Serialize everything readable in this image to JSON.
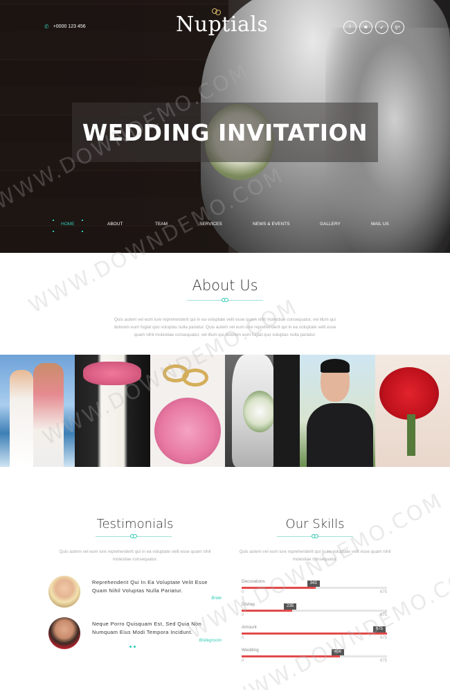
{
  "header": {
    "phone": "+0000 123 456",
    "phone_icon": "phone-icon",
    "logo_text": "Nuptials",
    "social": [
      {
        "icon": "facebook-icon",
        "glyph": "f"
      },
      {
        "icon": "instagram-icon",
        "glyph": "◙"
      },
      {
        "icon": "twitter-icon",
        "glyph": "✔"
      },
      {
        "icon": "google-plus-icon",
        "glyph": "g+"
      }
    ]
  },
  "hero": {
    "title": "WEDDING INVITATION"
  },
  "nav": [
    "HOME",
    "ABOUT",
    "TEAM",
    "SERVICES",
    "NEWS & EVENTS",
    "GALLERY",
    "MAIL US"
  ],
  "about": {
    "title": "About Us",
    "text_lines": [
      "Quis autem vel eum iure reprehenderit qui in ea voluptate velit esse quam nihil molestiae consequatur, vel illum qui",
      "dolorem eum fugiat quo voluptas nulla pariatur. Quis autem vel eum iure reprehenderit qui in ea voluptate velit esse",
      "quam nihil molestiae consequatur, vel illum qui dolorem eum fugiat quo voluptas nulla pariatur."
    ]
  },
  "testimonials": {
    "title": "Testimonials",
    "intro_lines": [
      "Quis autem vel eum iure reprehenderit qui in ea voluptate velit esse quam nihil",
      "molestiae consequatur."
    ],
    "items": [
      {
        "quote_lines": [
          "Reprehenderit Qui In Ea Voluptate Velit Esse",
          "Quam Nihil Voluptas Nulla Pariatur."
        ],
        "role": "Bride"
      },
      {
        "quote_lines": [
          "Neque Porro Quisquam Est, Sed Quia Non",
          "Numquam Eius Modi Tempora Incidunt."
        ],
        "role": "Bridegroom"
      }
    ]
  },
  "skills": {
    "title": "Our Skills",
    "intro_lines": [
      "Quis autem vel eum iure reprehenderit qui in ea voluptate velit esse quam nihil",
      "molestiae consequatur."
    ],
    "items": [
      {
        "label": "Decorations",
        "value": 343,
        "min": 0,
        "max": 675
      },
      {
        "label": "Dishes",
        "value": 235,
        "min": 0,
        "max": 675
      },
      {
        "label": "Amount",
        "value": 675,
        "min": 0,
        "max": 675
      },
      {
        "label": "Wedding",
        "value": 456,
        "min": 0,
        "max": 675
      }
    ]
  },
  "watermark": "WWW.DOWNDEMO.COM",
  "colors": {
    "accent": "#30c9b5",
    "skill_fill": "#e24a4a"
  }
}
